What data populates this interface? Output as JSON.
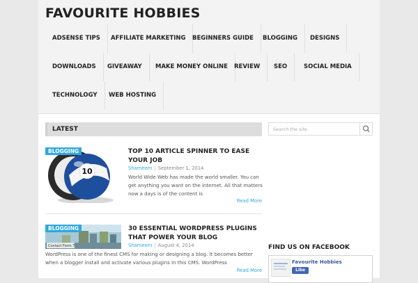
{
  "site": {
    "title": "FAVOURITE HOBBIES"
  },
  "nav": {
    "items": [
      "ADSENSE TIPS",
      "AFFILIATE MARKETING",
      "BEGINNERS GUIDE",
      "BLOGGING",
      "DESIGNS",
      "DOWNLOADS",
      "GIVEAWAY",
      "MAKE MONEY ONLINE",
      "REVIEW",
      "SEO",
      "SOCIAL MEDIA",
      "TECHNOLOGY",
      "WEB HOSTING"
    ]
  },
  "latest": {
    "heading": "LATEST"
  },
  "posts": [
    {
      "category": "BLOGGING",
      "title": "TOP 10 ARTICLE SPINNER TO EASE YOUR JOB",
      "author": "Shameem",
      "date": "September 1, 2014",
      "excerpt": "World Wide Web has made the world smaller. You can get anything you want on the internet. All that matters now a days is of the content is",
      "read_more": "Read More",
      "thumb_text": "10"
    },
    {
      "category": "BLOGGING",
      "title": "30 ESSENTIAL WORDPRESS PLUGINS THAT POWER YOUR BLOG",
      "author": "Shameem",
      "date": "August 4, 2014",
      "excerpt": "WordPress is one of the finest CMS for making or designing a blog. It becomes better when a blogger install and activate various plugins in this CMS. WordPress",
      "read_more": "Read More",
      "thumb_text": "Contact Form 7"
    }
  ],
  "sidebar": {
    "search_placeholder": "Search the site",
    "facebook_heading": "FIND US ON FACEBOOK",
    "facebook_page_name": "Favourite Hobbies",
    "facebook_like_label": "Like"
  },
  "colors": {
    "accent": "#2fa8dd",
    "facebook": "#4267b2"
  }
}
